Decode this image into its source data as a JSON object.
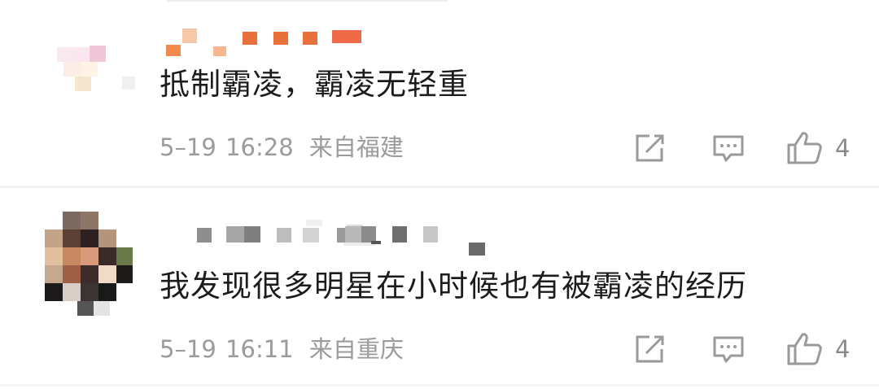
{
  "comments": [
    {
      "username_hidden": true,
      "text": "抵制霸凌，霸凌无轻重",
      "date": "5–19",
      "time": "16:28",
      "location": "来自福建",
      "likes": "4",
      "share_icon": "share-icon",
      "reply_icon": "comment-icon",
      "like_icon": "thumbs-up-icon"
    },
    {
      "username_hidden": true,
      "text": "我发现很多明星在小时候也有被霸凌的经历",
      "date": "5–19",
      "time": "16:11",
      "location": "来自重庆",
      "likes": "4",
      "share_icon": "share-icon",
      "reply_icon": "comment-icon",
      "like_icon": "thumbs-up-icon"
    }
  ],
  "colors": {
    "text": "#1c1c1c",
    "meta": "#9b9b9b",
    "icon": "#9a9a9a",
    "username_pixels": "#e8703a"
  }
}
